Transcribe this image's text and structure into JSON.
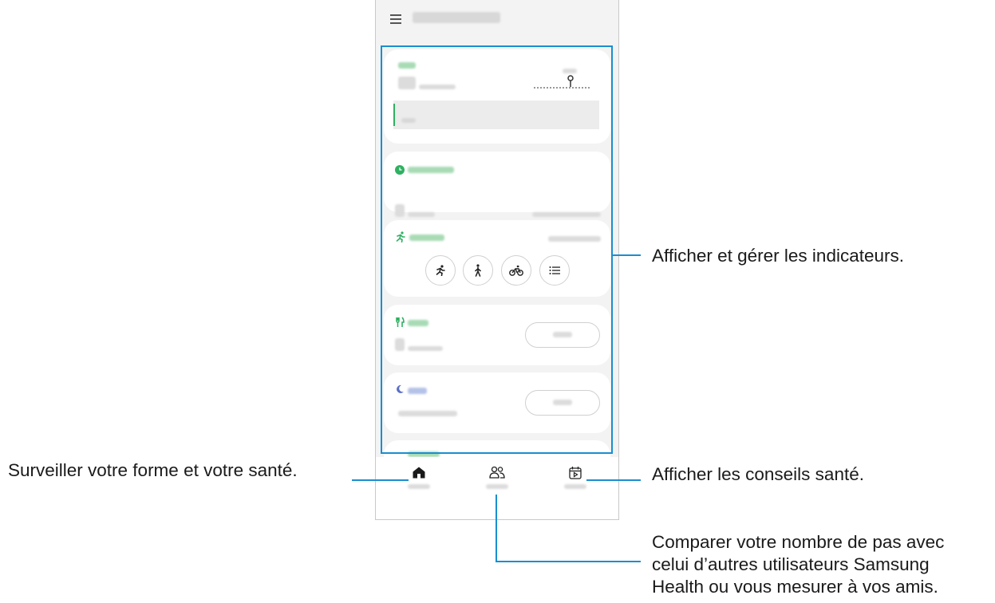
{
  "annotations": {
    "indicators": "Afficher et gérer les indicateurs.",
    "home": "Surveiller votre forme et votre santé.",
    "health_tips": "Afficher les conseils santé.",
    "together_line1": "Comparer votre nombre de pas avec",
    "together_line2": "celui d’autres utilisateurs Samsung",
    "together_line3": "Health ou vous mesurer à vos amis."
  },
  "colors": {
    "callout_line": "#1a8ecf",
    "accent_green": "#2fb062",
    "sleep_blue": "#5a6fc8"
  },
  "icons": {
    "menu": "hamburger-menu-icon",
    "pin": "map-pin-icon",
    "clock": "clock-icon",
    "exercise": "running-man-icon",
    "walk": "walking-man-icon",
    "bike": "bicycle-icon",
    "list": "list-icon",
    "food": "fork-knife-icon",
    "sleep": "moon-icon",
    "home": "home-icon",
    "together": "people-icon",
    "fitness": "calendar-play-icon"
  }
}
